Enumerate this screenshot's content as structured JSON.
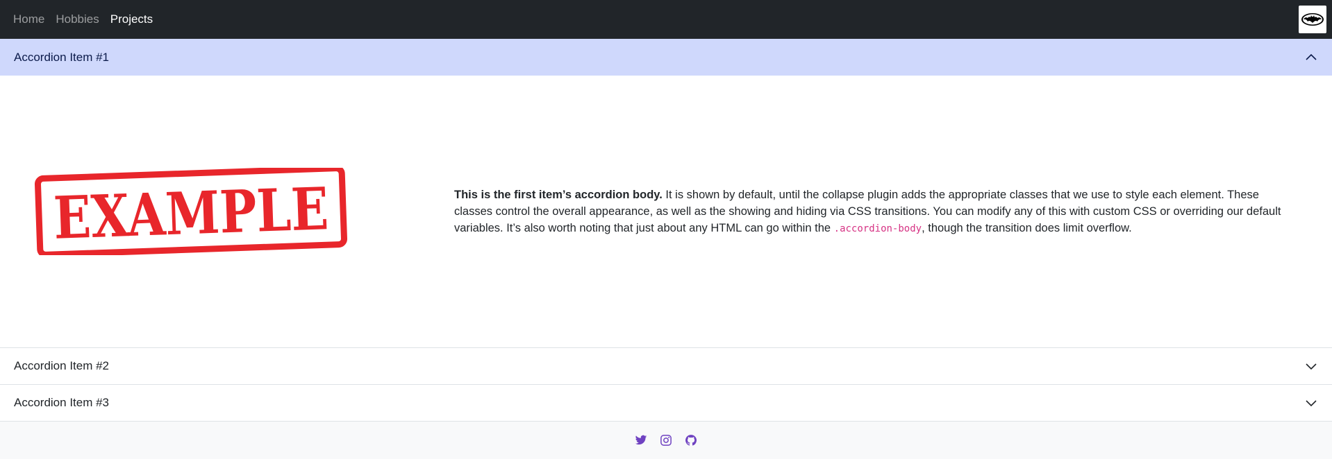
{
  "nav": {
    "links": [
      {
        "label": "Home"
      },
      {
        "label": "Hobbies"
      },
      {
        "label": "Projects"
      }
    ],
    "logo_icon": "bat-logo-icon"
  },
  "accordion": {
    "items": [
      {
        "label": "Accordion Item #1",
        "expanded": true
      },
      {
        "label": "Accordion Item #2",
        "expanded": false
      },
      {
        "label": "Accordion Item #3",
        "expanded": false
      }
    ],
    "body": {
      "image_text": "EXAMPLE",
      "bold_intro": "This is the first item’s accordion body.",
      "text_1": " It is shown by default, until the collapse plugin adds the appropriate classes that we use to style each element. These classes control the overall appearance, as well as the showing and hiding via CSS transitions. You can modify any of this with custom CSS or overriding our default variables. It’s also worth noting that just about any HTML can go within the ",
      "code": ".accordion-body",
      "text_2": ", though the transition does limit overflow."
    }
  },
  "footer": {
    "icons": [
      "twitter-icon",
      "instagram-icon",
      "github-icon"
    ],
    "icon_color": "#6f42c1"
  },
  "colors": {
    "navbar_bg": "#212529",
    "accordion_active_bg": "#cfd8fc",
    "stamp_red": "#e8262b",
    "code_pink": "#d63384"
  }
}
